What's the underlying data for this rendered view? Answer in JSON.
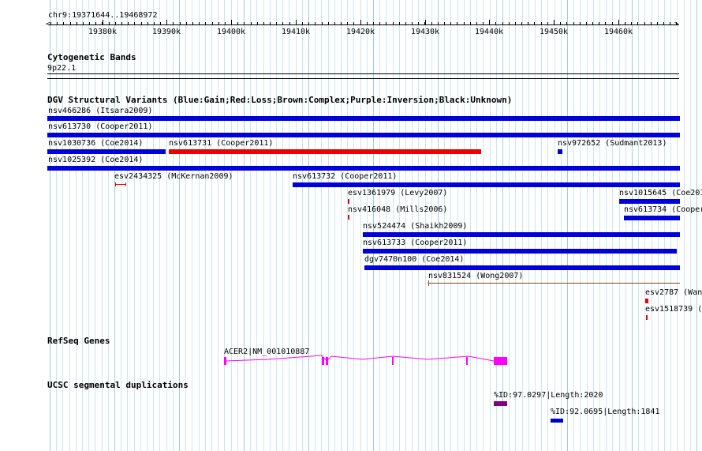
{
  "locus": "chr9:19371644..19468972",
  "axis_ticks": [
    "19380k",
    "19390k",
    "19400k",
    "19410k",
    "19420k",
    "19430k",
    "19440k",
    "19450k",
    "19460k"
  ],
  "tracks": {
    "cyto": {
      "title": "Cytogenetic Bands",
      "band": "9p22.1"
    },
    "dgv": {
      "title": "DGV Structural Variants (Blue:Gain;Red:Loss;Brown:Complex;Purple:Inversion;Black:Unknown)",
      "items": [
        "nsv466286 (Itsara2009)",
        "nsv613730 (Cooper2011)",
        "nsv1030736 (Coe2014)",
        "nsv613731 (Cooper2011)",
        "nsv972652 (Sudmant2013)",
        "nsv1025392 (Coe2014)",
        "esv2434325 (McKernan2009)",
        "nsv613732 (Cooper2011)",
        "esv1361979 (Levy2007)",
        "nsv1015645 (Coe201",
        "nsv416048 (Mills2006)",
        "nsv613734 (Cooper",
        "nsv524474 (Shaikh2009)",
        "nsv613733 (Cooper2011)",
        "dgv7470n100 (Coe2014)",
        "nsv831524 (Wong2007)",
        "esv2787 (Wan",
        "esv1518739 ("
      ]
    },
    "refseq": {
      "title": "RefSeq Genes",
      "gene": "ACER2|NM_001010887"
    },
    "segdup": {
      "title": "UCSC segmental duplications",
      "items": [
        "%ID:97.0297|Length:2020",
        "%ID:92.0695|Length:1841"
      ]
    }
  },
  "colors": {
    "gain": "#0000dd",
    "loss": "#ee0000",
    "complex": "#8b4513",
    "gene": "#ff00ff",
    "segdup_high": "#800080",
    "segdup_low": "#0000cc"
  }
}
